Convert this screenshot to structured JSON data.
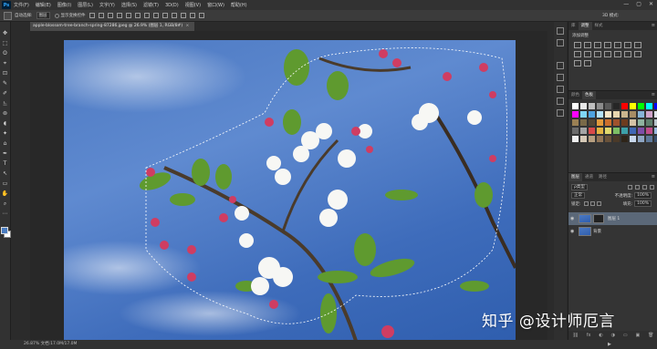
{
  "app": {
    "logo": "Ps"
  },
  "menubar": {
    "items": [
      "文件(F)",
      "编辑(E)",
      "图像(I)",
      "图层(L)",
      "文字(Y)",
      "选择(S)",
      "滤镜(T)",
      "3D(D)",
      "视图(V)",
      "窗口(W)",
      "帮助(H)"
    ],
    "window_controls": [
      "—",
      "▢",
      "✕"
    ]
  },
  "options": {
    "auto_select_label": "自动选择:",
    "auto_select_value": "图层",
    "show_transform_label": "显示变换控件",
    "mode_label": "3D 模式:"
  },
  "document": {
    "tab_title": "apple-blossom-tree-branch-spring-87286.jpeg @ 26.9% (图层 1, RGB/8#)",
    "tab_close": "×"
  },
  "tools": [
    "✥",
    "⬚",
    "ʘ",
    "⌖",
    "⊡",
    "✎",
    "✐",
    "⎁",
    "⊚",
    "◖",
    "✦",
    "⌂",
    "✒",
    "T",
    "↖",
    "▭",
    "✋",
    "⌕",
    "⋯"
  ],
  "colors": {
    "foreground": "#4a7cc0",
    "background": "#ffffff",
    "accent_selected_layer": "#5b6878"
  },
  "statusbar": {
    "zoom_and_info": "26.87%   文档:17.0M/17.0M",
    "arrow": "▶"
  },
  "panels": {
    "adjustments": {
      "tabs": [
        "库",
        "调整",
        "样式"
      ],
      "active_tab": 1,
      "add_label": "添加调整",
      "icons": [
        "brightness-icon",
        "levels-icon",
        "curves-icon",
        "exposure-icon",
        "vibrance-icon",
        "hue-icon",
        "balance-icon",
        "bw-icon",
        "photo-filter-icon",
        "channel-mixer-icon",
        "color-lookup-icon",
        "invert-icon",
        "posterize-icon",
        "threshold-icon",
        "gradient-map-icon",
        "selective-color-icon"
      ]
    },
    "swatches": {
      "tabs": [
        "颜色",
        "色板"
      ],
      "active_tab": 1,
      "colors": [
        "#ffffff",
        "#e8e8e8",
        "#bfbfbf",
        "#8c8c8c",
        "#5a5a5a",
        "#262626",
        "#ff0000",
        "#ffff00",
        "#00ff00",
        "#00ffff",
        "#0000ff",
        "#ff00ff",
        "#7fd6f6",
        "#4fa3e0",
        "#b4e2f9",
        "#f5e6c8",
        "#e8d7b0",
        "#c9b58e",
        "#a78c65",
        "#88b4d8",
        "#cfa3c9",
        "#dfe4ea",
        "#9a8054",
        "#7a6a48",
        "#544734",
        "#e39a3a",
        "#cb6f2c",
        "#a0522d",
        "#6e3b1f",
        "#d4c2a6",
        "#8fb3a0",
        "#5e7f6d",
        "#b8c4cc",
        "#6b6b6b",
        "#a5a5a5",
        "#d84a4a",
        "#e5b442",
        "#e0d86d",
        "#7cbf65",
        "#3ca0a8",
        "#3f67b5",
        "#7e4ea8",
        "#c04e8a",
        "#9ab8de",
        "#efefef",
        "#d6c9b7",
        "#b79f80",
        "#917456",
        "#6a523a",
        "#4b3a29",
        "#2e2418",
        "#c8d8ec",
        "#8ea6c4",
        "#5d7899",
        "#394f6d"
      ]
    },
    "layers": {
      "tabs": [
        "图层",
        "通道",
        "路径"
      ],
      "active_tab": 0,
      "kind_label": "ρ类型",
      "blend_mode": "正常",
      "opacity_label": "不透明度:",
      "opacity_value": "100%",
      "lock_label": "锁定:",
      "fill_label": "填充:",
      "fill_value": "100%",
      "items": [
        {
          "name": "图层 1",
          "selected": true
        },
        {
          "name": "背景",
          "selected": false
        }
      ],
      "footer": [
        "⛓",
        "fx",
        "◐",
        "◑",
        "▭",
        "▣",
        "🗑"
      ]
    }
  },
  "watermark": {
    "text": "知乎 @设计师厄言"
  }
}
